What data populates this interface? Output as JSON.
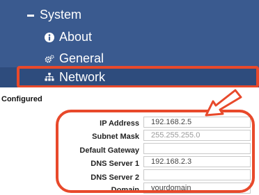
{
  "sidebar": {
    "items": [
      {
        "label": "System",
        "icon": "minus-icon"
      },
      {
        "label": "About",
        "icon": "info-circle-icon"
      },
      {
        "label": "General",
        "icon": "cogs-icon"
      },
      {
        "label": "Network",
        "icon": "sitemap-icon"
      }
    ]
  },
  "panel": {
    "status": "Configured",
    "fields": [
      {
        "label": "IP Address",
        "value": "192.168.2.5"
      },
      {
        "label": "Subnet Mask",
        "value": "",
        "placeholder": "255.255.255.0"
      },
      {
        "label": "Default Gateway",
        "value": ""
      },
      {
        "label": "DNS Server 1",
        "value": "192.168.2.3"
      },
      {
        "label": "DNS Server 2",
        "value": ""
      },
      {
        "label": "Domain",
        "value": "yourdomain"
      }
    ]
  },
  "colors": {
    "sidebar_bg": "#3a5a8f",
    "sidebar_active_bg": "#2e4c7d",
    "highlight": "#e8492b"
  }
}
